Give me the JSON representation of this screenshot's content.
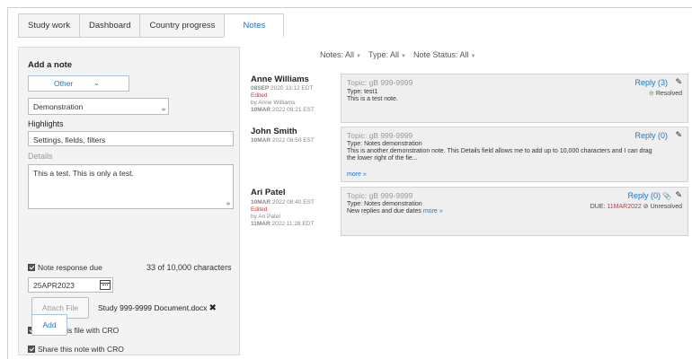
{
  "tabs": [
    {
      "label": "Study work"
    },
    {
      "label": "Dashboard"
    },
    {
      "label": "Country progress"
    },
    {
      "label": "Notes"
    }
  ],
  "form": {
    "title": "Add a note",
    "type_select": "Other",
    "title_value": "Demonstration",
    "highlights_label": "Highlights",
    "highlights_value": "Settings, fields, filters",
    "details_label": "Details",
    "details_value": "This a test. This is only a test.",
    "response_due_label": "Note response due",
    "char_count": "33 of 10,000 characters",
    "due_date": "25APR2023",
    "attach_label": "Attach File",
    "attached_file": "Study 999-9999 Document.docx",
    "share_file_label": "Share this file with CRO",
    "share_note_label": "Share this note with CRO",
    "add_label": "Add"
  },
  "filters": {
    "notes": "Notes: All",
    "type": "Type: All",
    "status": "Note Status: All"
  },
  "notes": [
    {
      "author": "Anne Williams",
      "date_day": "08SEP",
      "date_rest": " 2020 13:12 EDT",
      "edited": "Edited",
      "edited_by": "by Anne Williams",
      "edited_day": "10MAR",
      "edited_rest": " 2022 09:21 EST",
      "topic": "Topic: gB 999-9999",
      "type": "Type: test1",
      "body": "This is a test note.",
      "reply": "Reply (3)",
      "status": "Resolved"
    },
    {
      "author": "John Smith",
      "date_day": "10MAR",
      "date_rest": " 2022 08:50 EST",
      "topic": "Topic: gB 999-9999",
      "type": "Type: Notes demonstration",
      "body1": "This is another demonstration note. This Details field allows me to add up to 10,000 characters and I can drag",
      "body2": "the lower right of the fie...",
      "more": "more »",
      "reply": "Reply (0)"
    },
    {
      "author": "Ari Patel",
      "date_day": "10MAR",
      "date_rest": " 2022 08:40 EST",
      "edited": "Edited",
      "edited_by": "by Ari Patel",
      "edited_day": "11MAR",
      "edited_rest": " 2022 11:28 EDT",
      "topic": "Topic: gB 999-9999",
      "type": "Type: Notes demonstration",
      "body": "New replies and due dates",
      "more": "more »",
      "reply": "Reply (0)",
      "due_label": "DUE:",
      "due_date": "11MAR2022",
      "status": "Unresolved"
    }
  ],
  "icons": {
    "select": "chevron-down-icon",
    "calendar": "calendar-icon",
    "remove": "close-icon",
    "edit": "pencil-icon",
    "attachment": "paperclip-icon",
    "resolved": "check-circle-icon",
    "unresolved": "circle-slash-icon"
  },
  "colors": {
    "accent": "#1e76c6",
    "alert": "#d0343a",
    "success": "#3f9b3f"
  }
}
